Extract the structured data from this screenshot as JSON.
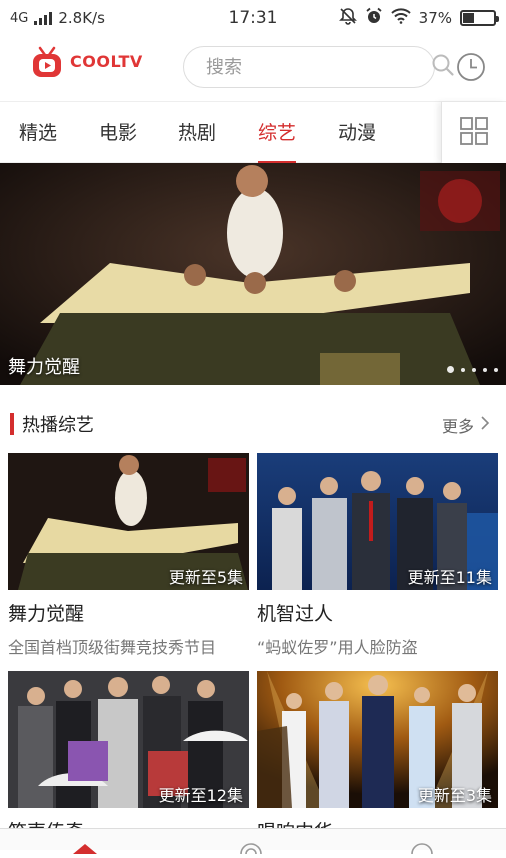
{
  "status_bar": {
    "network": "4G",
    "speed": "2.8K/s",
    "time": "17:31",
    "battery": "37%",
    "battery_level": 0.37
  },
  "header": {
    "logo_text": "COOLTV",
    "search_placeholder": "搜索"
  },
  "tabs": [
    {
      "label": "精选",
      "active": false
    },
    {
      "label": "电影",
      "active": false
    },
    {
      "label": "热剧",
      "active": false
    },
    {
      "label": "综艺",
      "active": true
    },
    {
      "label": "动漫",
      "active": false
    }
  ],
  "banner": {
    "title": "舞力觉醒",
    "slide_count": 5,
    "active_slide": 0
  },
  "section": {
    "title": "热播综艺",
    "more_label": "更多"
  },
  "cards": [
    {
      "update": "更新至5集",
      "title": "舞力觉醒",
      "desc": "全国首档顶级街舞竞技秀节目"
    },
    {
      "update": "更新至11集",
      "title": "机智过人",
      "desc": "“蚂蚁佐罗”用人脸防盗"
    },
    {
      "update": "更新至12集",
      "title": "笑声传奇",
      "desc": ""
    },
    {
      "update": "更新至3集",
      "title": "唱响中华",
      "desc": ""
    }
  ],
  "colors": {
    "accent": "#d42e2e",
    "logo": "#e03636"
  }
}
